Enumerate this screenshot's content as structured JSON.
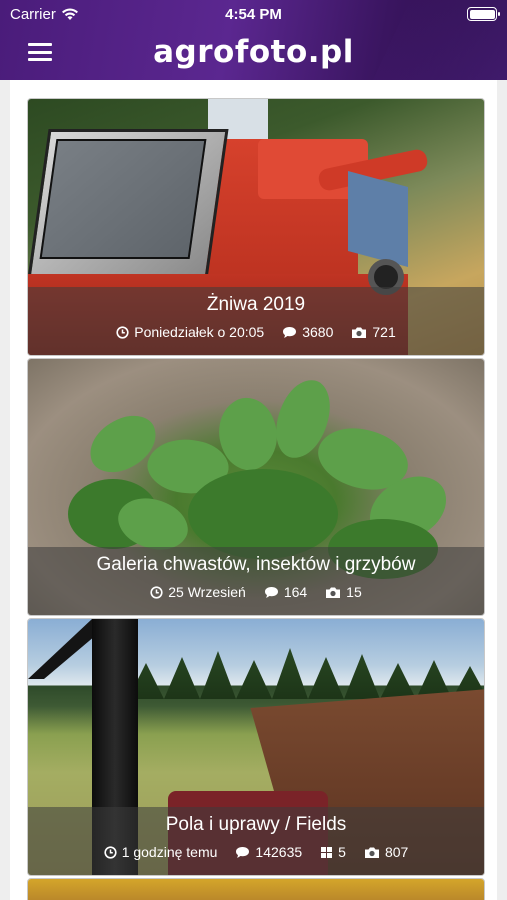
{
  "status_bar": {
    "carrier": "Carrier",
    "time": "4:54 PM"
  },
  "header": {
    "logo": "agrofoto.pl",
    "menu_icon": "hamburger-menu-icon"
  },
  "galleries": [
    {
      "title": "Żniwa 2019",
      "date": "Poniedziałek o 20:05",
      "comments": "3680",
      "photos": "721"
    },
    {
      "title": "Galeria chwastów, insektów i grzybów",
      "date": "25 Wrzesień",
      "comments": "164",
      "photos": "15"
    },
    {
      "title": "Pola i uprawy / Fields",
      "date": "1 godzinę temu",
      "comments": "142635",
      "albums": "5",
      "photos": "807"
    }
  ],
  "colors": {
    "header": "#4a1c7a",
    "overlay": "rgba(60,60,60,0.55)",
    "text": "#ffffff"
  }
}
